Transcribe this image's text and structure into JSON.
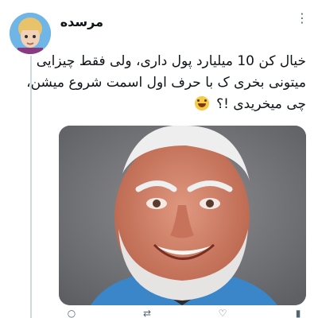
{
  "tweet": {
    "author": {
      "display_name": "مرسده"
    },
    "text_lines": [
      "خیال کن 10 میلیارد پول داری، ولی فقط چیزایی",
      "میتونی بخری ک با حرف اول اسمت شروع میشن،",
      "چی میخریدی !؟"
    ],
    "emoji": "grinning-sweat-face",
    "more_icon": "more-vertical-icon"
  },
  "actions": [
    "reply-icon",
    "retweet-icon",
    "like-icon",
    "views-icon"
  ]
}
